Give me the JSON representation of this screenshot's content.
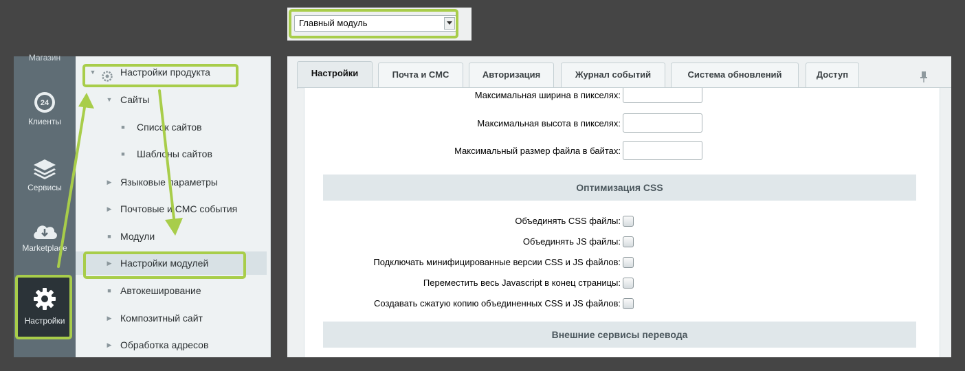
{
  "module_select": {
    "value": "Главный модуль"
  },
  "sidebar_left": {
    "top_label": "Магазин",
    "items": [
      {
        "label": "Клиенты",
        "badge": "24"
      },
      {
        "label": "Сервисы"
      },
      {
        "label": "Marketplace"
      },
      {
        "label": "Настройки"
      }
    ]
  },
  "tree": {
    "items": [
      {
        "label": "Настройки продукта"
      },
      {
        "label": "Сайты"
      },
      {
        "label": "Список сайтов"
      },
      {
        "label": "Шаблоны сайтов"
      },
      {
        "label": "Языковые параметры"
      },
      {
        "label": "Почтовые и СМС события"
      },
      {
        "label": "Модули"
      },
      {
        "label": "Настройки модулей"
      },
      {
        "label": "Автокеширование"
      },
      {
        "label": "Композитный сайт"
      },
      {
        "label": "Обработка адресов"
      }
    ]
  },
  "tabs": [
    {
      "label": "Настройки"
    },
    {
      "label": "Почта и СМС"
    },
    {
      "label": "Авторизация"
    },
    {
      "label": "Журнал событий"
    },
    {
      "label": "Система обновлений"
    },
    {
      "label": "Доступ"
    }
  ],
  "fields": {
    "max_width": "Максимальная ширина в пикселях:",
    "max_height": "Максимальная высота в пикселях:",
    "max_size": "Максимальный размер файла в байтах:"
  },
  "sections": {
    "css_opt": "Оптимизация CSS",
    "translate": "Внешние сервисы перевода"
  },
  "checkboxes": [
    {
      "label": "Объединять CSS файлы:"
    },
    {
      "label": "Объединять JS файлы:"
    },
    {
      "label": "Подключать минифицированные версии CSS и JS файлов:"
    },
    {
      "label": "Переместить весь Javascript в конец страницы:"
    },
    {
      "label": "Создавать сжатую копию объединенных CSS и JS файлов:"
    }
  ],
  "colors": {
    "highlight": "#a8cd4a",
    "sidebar": "#5f6d75",
    "sidebar_active": "#2b3338",
    "background": "#454545"
  }
}
